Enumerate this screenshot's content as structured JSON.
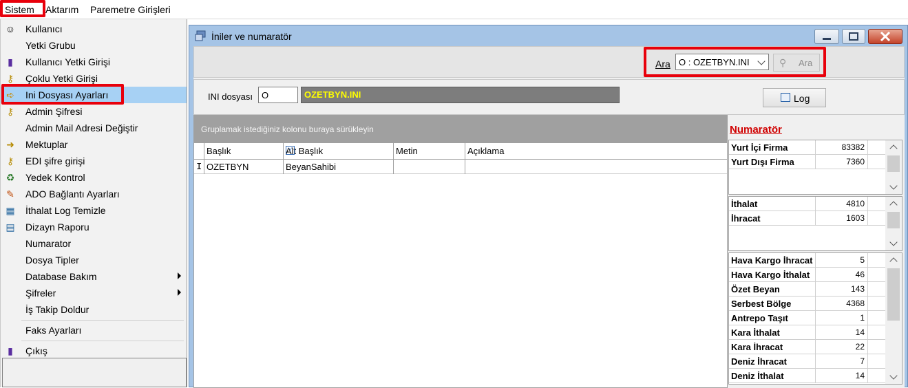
{
  "menubar": {
    "items": [
      "Sistem",
      "Aktarım",
      "Paremetre Girişleri"
    ]
  },
  "dropdown": {
    "items": [
      {
        "label": "Kullanıcı",
        "icon": "user-icon"
      },
      {
        "label": "Yetki Grubu",
        "icon": ""
      },
      {
        "label": "Kullanıcı Yetki Girişi",
        "icon": "book-icon"
      },
      {
        "label": "Çoklu Yetki Girişi",
        "icon": "key-icon"
      },
      {
        "label": "Ini Dosyası  Ayarları",
        "icon": "folder-arrow-icon",
        "selected": true
      },
      {
        "label": "Admin Şifresi",
        "icon": "key-icon"
      },
      {
        "label": "Admin Mail Adresi Değiştir",
        "icon": ""
      },
      {
        "label": "Mektuplar",
        "icon": "send-icon"
      },
      {
        "label": "EDI şifre girişi",
        "icon": "key-icon"
      },
      {
        "label": "Yedek Kontrol",
        "icon": "backup-icon"
      },
      {
        "label": "ADO Bağlantı Ayarları",
        "icon": "connection-icon"
      },
      {
        "label": "İthalat Log Temizle",
        "icon": "clean-icon"
      },
      {
        "label": "Dizayn Raporu",
        "icon": "report-icon"
      },
      {
        "label": "Numarator",
        "icon": ""
      },
      {
        "label": "Dosya Tipler",
        "icon": ""
      },
      {
        "label": "Database Bakım",
        "icon": "",
        "submenu": true
      },
      {
        "label": "Şifreler",
        "icon": "",
        "submenu": true
      },
      {
        "label": "İş Takip Doldur",
        "icon": ""
      },
      {
        "label": "Faks Ayarları",
        "icon": ""
      },
      {
        "label": "Çıkış",
        "icon": "exit-icon"
      }
    ]
  },
  "window": {
    "title": "İniler ve numaratör",
    "search": {
      "label": "Ara",
      "selected": "O : OZETBYN.INI",
      "button": "Ara"
    },
    "ini": {
      "label": "INI dosyası",
      "code": "O",
      "name": "OZETBYN.INI",
      "log_button": "Log"
    },
    "grid": {
      "group_hint": "Gruplamak istediğiniz kolonu buraya sürükleyin",
      "columns": [
        "Başlık",
        "Alt Başlık",
        "Metin",
        "Açıklama"
      ],
      "rows": [
        [
          "OZETBYN",
          "BeyanSahibi",
          "",
          ""
        ]
      ]
    },
    "numarator": {
      "title": "Numaratör",
      "group1": [
        {
          "label": "Yurt İçi Firma",
          "value": "83382"
        },
        {
          "label": "Yurt Dışı Firma",
          "value": "7360"
        }
      ],
      "group2": [
        {
          "label": "İthalat",
          "value": "4810"
        },
        {
          "label": "İhracat",
          "value": "1603"
        }
      ],
      "group3": [
        {
          "label": "Hava Kargo İhracat",
          "value": "5"
        },
        {
          "label": "Hava Kargo İthalat",
          "value": "46"
        },
        {
          "label": "Özet Beyan",
          "value": "143"
        },
        {
          "label": "Serbest Bölge",
          "value": "4368"
        },
        {
          "label": "Antrepo Taşıt",
          "value": "1"
        },
        {
          "label": "Kara İthalat",
          "value": "14"
        },
        {
          "label": "Kara İhracat",
          "value": "22"
        },
        {
          "label": "Deniz İhracat",
          "value": "7"
        },
        {
          "label": "Deniz İthalat",
          "value": "14"
        }
      ]
    }
  },
  "colors": {
    "highlight": "#e8000b",
    "selected_menu": "#a7d1f4",
    "ini_name_text": "#ffff00",
    "numarator_title": "#d00000"
  }
}
